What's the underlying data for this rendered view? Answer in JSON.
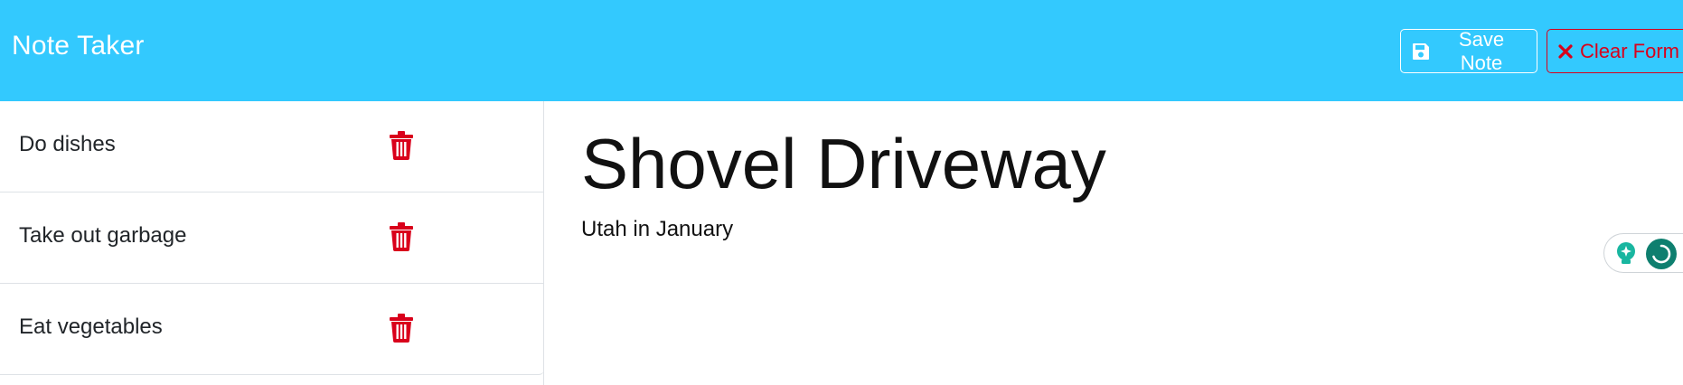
{
  "navbar": {
    "brand": "Note Taker",
    "save_label": "Save Note",
    "clear_label": "Clear Form",
    "save_icon": "floppy-disk-icon",
    "clear_icon": "x-mark-icon"
  },
  "sidebar": {
    "items": [
      {
        "title": "Do dishes",
        "icon": "trash-icon"
      },
      {
        "title": "Take out garbage",
        "icon": "trash-icon"
      },
      {
        "title": "Eat vegetables",
        "icon": "trash-icon"
      }
    ]
  },
  "note": {
    "title": "Shovel Driveway",
    "text": "Utah in January"
  },
  "colors": {
    "navbar_bg": "#33c9fe",
    "danger": "#d9001b",
    "widget_green": "#0e7f6f"
  }
}
